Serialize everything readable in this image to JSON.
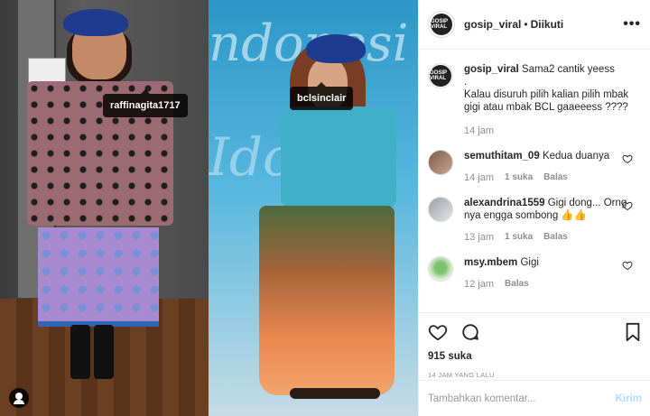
{
  "photo": {
    "tag_left": "raffinagita1717",
    "tag_right": "bclsinclair",
    "bg_text_top": "ndonesi",
    "bg_text_bottom": "Ido"
  },
  "header": {
    "avatar_text": "GOSIP VIRAL",
    "username": "gosip_viral",
    "separator": "•",
    "follow_status": "Diikuti",
    "more_label": "•••"
  },
  "caption": {
    "username": "gosip_viral",
    "text_line1": "Sama2 cantik yeess",
    "text_line2": ".",
    "text_line3": "Kalau disuruh pilih kalian pilih mbak gigi atau mbak BCL gaaeeess ????",
    "time": "14 jam"
  },
  "comments": [
    {
      "username": "semuthitam_09",
      "text": "Kedua duanya",
      "time": "14 jam",
      "likes": "1 suka",
      "reply": "Balas"
    },
    {
      "username": "alexandrina1559",
      "text": "Gigi dong... Orng nya engga sombong 👍👍",
      "time": "13 jam",
      "likes": "1 suka",
      "reply": "Balas"
    },
    {
      "username": "msy.mbem",
      "text": "Gigi",
      "time": "12 jam",
      "likes": "",
      "reply": "Balas"
    }
  ],
  "post": {
    "likes": "915 suka",
    "time": "14 JAM YANG LALU"
  },
  "add_comment": {
    "placeholder": "Tambahkan komentar...",
    "post_label": "Kirim"
  },
  "icons": [
    "heart-icon",
    "comment-icon",
    "bookmark-icon",
    "more-icon",
    "user-tag-icon"
  ],
  "colors": {
    "text": "#262626",
    "muted": "#8e8e8e",
    "post_button": "#b2dffc",
    "border": "#efefef"
  }
}
